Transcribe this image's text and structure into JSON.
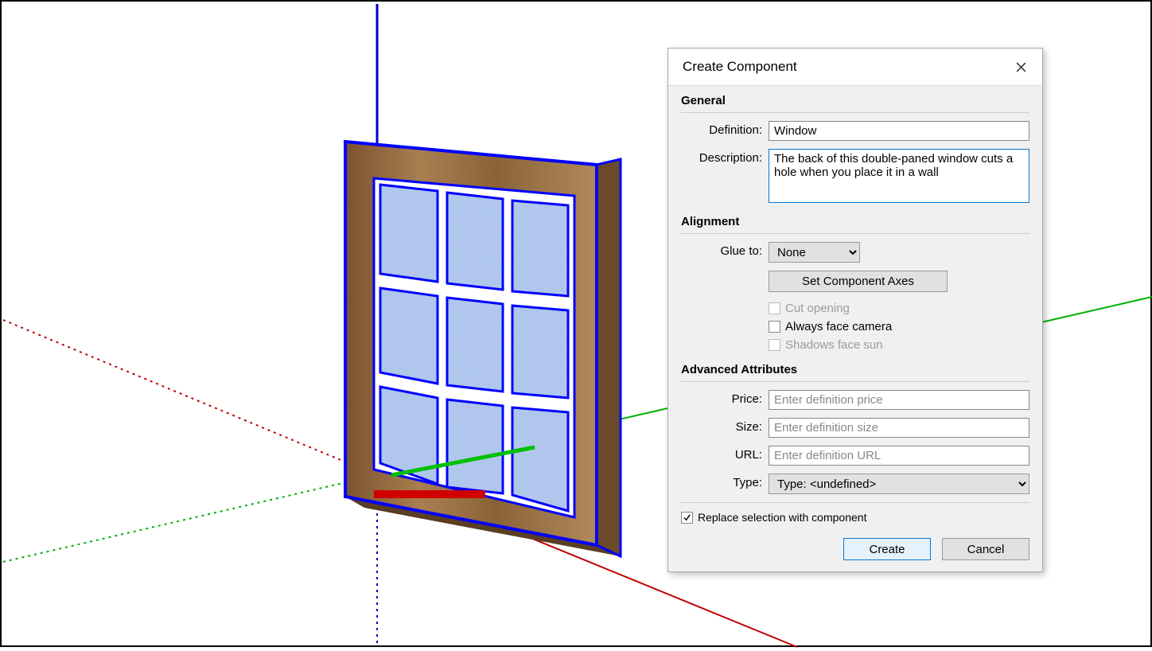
{
  "dialog": {
    "title": "Create Component",
    "sections": {
      "general": "General",
      "alignment": "Alignment",
      "advanced": "Advanced Attributes"
    },
    "labels": {
      "definition": "Definition:",
      "description": "Description:",
      "glue_to": "Glue to:",
      "price": "Price:",
      "size": "Size:",
      "url": "URL:",
      "type": "Type:"
    },
    "values": {
      "definition": "Window",
      "description": "The back of this double-paned window cuts a hole when you place it in a wall",
      "glue_to_selected": "None",
      "type_selected": "Type: <undefined>"
    },
    "placeholders": {
      "price": "Enter definition price",
      "size": "Enter definition size",
      "url": "Enter definition URL"
    },
    "buttons": {
      "set_axes": "Set Component Axes",
      "create": "Create",
      "cancel": "Cancel"
    },
    "checkboxes": {
      "cut_opening": "Cut opening",
      "face_camera": "Always face camera",
      "shadows_sun": "Shadows face sun",
      "replace_selection": "Replace selection with component"
    }
  }
}
